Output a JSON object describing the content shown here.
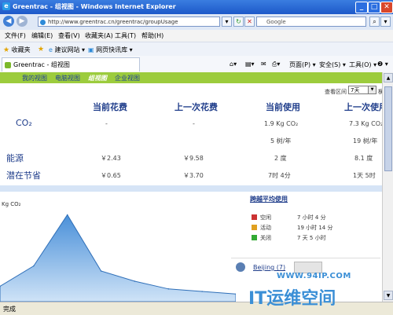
{
  "window": {
    "title": "Greentrac - 组视图 - Windows Internet Explorer"
  },
  "address": {
    "url": "http://www.greentrac.cn/greentrac/groupUsage",
    "search_placeholder": "Google"
  },
  "menu": [
    "文件(F)",
    "编辑(E)",
    "查看(V)",
    "收藏夹(A)",
    "工具(T)",
    "帮助(H)"
  ],
  "favorites": {
    "label": "收藏夹",
    "items": [
      "建议网站 ▾",
      "网页快讯库 ▾"
    ]
  },
  "tab": {
    "label": "Greentrac - 组视图"
  },
  "commands": [
    "页面(P) ▾",
    "安全(S) ▾",
    "工具(O) ▾",
    "❷ ▾"
  ],
  "nav": {
    "items": [
      "我的视图",
      "电脑视图",
      "组视图",
      "企业视图"
    ],
    "active_index": 2
  },
  "filter": {
    "label": "查看区间",
    "value": "7天",
    "extra": "横"
  },
  "table": {
    "columns": [
      "当前花费",
      "上一次花费",
      "当前使用",
      "上一次使用"
    ],
    "rows": [
      {
        "label": "CO₂",
        "values": [
          "-",
          "-",
          "1.9 Kg CO₂",
          "7.3 Kg CO₂"
        ],
        "sub": [
          "",
          "",
          "5 树/年",
          "19 树/年"
        ]
      },
      {
        "label": "能源",
        "values": [
          "￥2.43",
          "￥9.58",
          "2 度",
          "8.1 度"
        ]
      },
      {
        "label": "潜在节省",
        "values": [
          "￥0.65",
          "￥3.70",
          "7时 4分",
          "1天 5时"
        ]
      }
    ]
  },
  "chart": {
    "ylabel": "Kg CO₂"
  },
  "chart_data": {
    "type": "area",
    "ylabel": "Kg CO₂",
    "x": [
      0,
      1,
      2,
      3,
      4,
      5,
      6,
      7
    ],
    "values": [
      0.3,
      0.7,
      1.7,
      0.6,
      0.4,
      0.25,
      0.2,
      0.15
    ],
    "grid": false,
    "color": "#4a90d9"
  },
  "legend": {
    "title": "跨越平均使用",
    "items": [
      {
        "name": "空闲",
        "value": "7 小时 4 分",
        "color": "#cc3333"
      },
      {
        "name": "活动",
        "value": "19 小时 14 分",
        "color": "#e0a020"
      },
      {
        "name": "关闭",
        "value": "7 天 5 小时",
        "color": "#33aa33"
      }
    ]
  },
  "group": {
    "name": "Beijing (7)"
  },
  "status": {
    "text": "完成"
  },
  "watermark": {
    "url": "WWW.94IP.COM",
    "text": "IT运维空间"
  }
}
